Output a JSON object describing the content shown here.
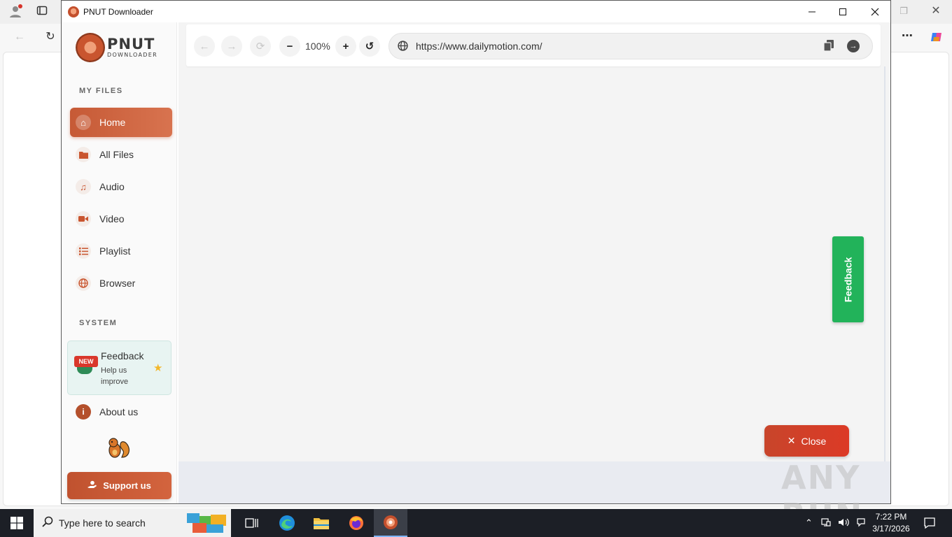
{
  "window": {
    "title": "PNUT Downloader"
  },
  "sidebar": {
    "logo_main": "PNUT",
    "logo_sub": "DOWNLOADER",
    "my_files_label": "MY FILES",
    "items": [
      {
        "label": "Home",
        "icon": "home-icon",
        "active": true
      },
      {
        "label": "All Files",
        "icon": "folder-icon",
        "active": false
      },
      {
        "label": "Audio",
        "icon": "music-icon",
        "active": false
      },
      {
        "label": "Video",
        "icon": "video-icon",
        "active": false
      },
      {
        "label": "Playlist",
        "icon": "list-icon",
        "active": false
      },
      {
        "label": "Browser",
        "icon": "globe-icon",
        "active": false
      }
    ],
    "system_label": "SYSTEM",
    "feedback_card": {
      "badge": "NEW",
      "title": "Feedback",
      "subtitle": "Help us improve"
    },
    "about_label": "About us",
    "support_label": "Support us"
  },
  "toolbar": {
    "zoom": "100%",
    "url": "https://www.dailymotion.com/"
  },
  "feedback_tab_label": "Feedback",
  "close_button_label": "Close",
  "watermark": "ANY RUN",
  "taskbar": {
    "search_placeholder": "Type here to search",
    "time": "7:22 PM",
    "date": "3/17/2026"
  },
  "colors": {
    "brand_orange": "#c65a36",
    "feedback_green": "#22b35a",
    "close_red": "#dc3a26"
  }
}
